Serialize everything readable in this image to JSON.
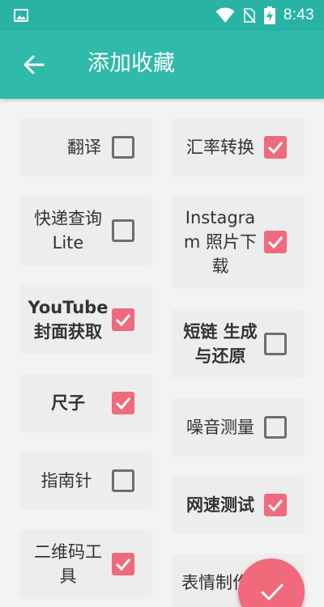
{
  "status_bar": {
    "time": "8:43",
    "icons": [
      "image-icon",
      "wifi-icon",
      "no-sim-icon",
      "battery-charging-icon"
    ]
  },
  "app_bar": {
    "title": "添加收藏",
    "back_icon": "arrow-back-icon"
  },
  "colors": {
    "status_bar": "#29b3a4",
    "app_bar": "#2fbaa9",
    "checked": "#ef6a7d",
    "card": "#ededed",
    "fab": "#f06a7b"
  },
  "tools": {
    "left": [
      {
        "label": "翻译",
        "checked": false
      },
      {
        "label": "快递查询 Lite",
        "checked": false
      },
      {
        "label": "YouTube封面获取",
        "checked": true
      },
      {
        "label": "尺子",
        "checked": true
      },
      {
        "label": "指南针",
        "checked": false
      },
      {
        "label": "二维码工具",
        "checked": true
      }
    ],
    "right": [
      {
        "label": "汇率转换",
        "checked": true
      },
      {
        "label": "Instagram 照片下载",
        "checked": true
      },
      {
        "label": "短链 生成与还原",
        "checked": false
      },
      {
        "label": "噪音测量",
        "checked": false
      },
      {
        "label": "网速测试",
        "checked": true
      },
      {
        "label": "表情制作",
        "checked": false
      }
    ]
  },
  "fab": {
    "icon": "check-icon"
  }
}
